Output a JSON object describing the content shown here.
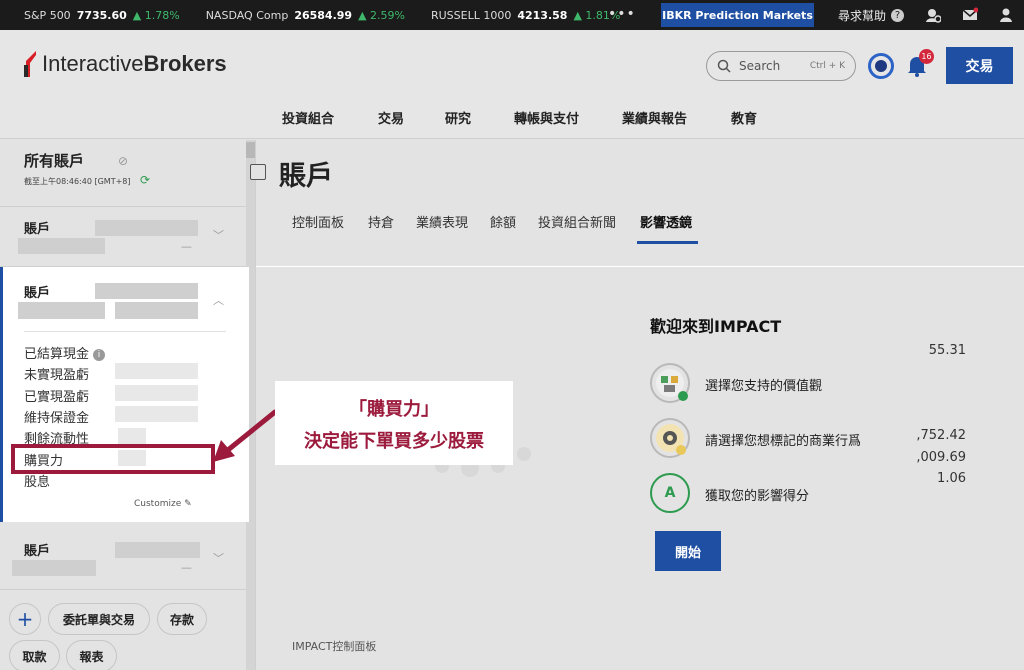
{
  "ticker": [
    {
      "name": "S&P 500",
      "value": "7735.60",
      "change": "▲ 1.78%"
    },
    {
      "name": "NASDAQ Comp",
      "value": "26584.99",
      "change": "▲ 2.59%"
    },
    {
      "name": "RUSSELL 1000",
      "value": "4213.58",
      "change": "▲ 1.81%"
    }
  ],
  "topbar": {
    "more": "•••",
    "predict_label": "IBKR Prediction Markets",
    "help_label": "尋求幫助"
  },
  "brand": {
    "name_regular": "Interactive",
    "name_bold": "Brokers"
  },
  "search": {
    "placeholder": "Search",
    "shortcut": "Ctrl + K"
  },
  "notifications": {
    "count": "16"
  },
  "trade_button": "交易",
  "nav": [
    "投資組合",
    "交易",
    "研究",
    "轉帳與支付",
    "業績與報告",
    "教育"
  ],
  "sidebar": {
    "title": "所有賬戶",
    "as_of": "截至上午08:46:40 [GMT+8]",
    "account_label": "賬戶",
    "rows": [
      {
        "label": "已結算現金",
        "value": "55.31"
      },
      {
        "label": "未實現盈虧",
        "value": ""
      },
      {
        "label": "已實現盈虧",
        "value": ""
      },
      {
        "label": "維持保證金",
        "value": ""
      },
      {
        "label": "剩餘流動性",
        "value": ",752.42"
      },
      {
        "label": "購買力",
        "value": ",009.69"
      },
      {
        "label": "股息",
        "value": "1.06"
      }
    ],
    "customize": "Customize",
    "buttons": {
      "orders": "委託單與交易",
      "deposit": "存款",
      "withdraw": "取款",
      "reports": "報表",
      "plus": "+"
    }
  },
  "main": {
    "title": "賬戶",
    "tabs": [
      "控制面板",
      "持倉",
      "業績表現",
      "餘額",
      "投資組合新聞",
      "影響透鏡"
    ],
    "active_tab": "影響透鏡",
    "welcome": "歡迎來到IMPACT",
    "steps": [
      "選擇您支持的價值觀",
      "請選擇您想標記的商業行爲",
      "獲取您的影響得分"
    ],
    "step_grade": "A",
    "start": "開始",
    "footer": "IMPACT控制面板"
  },
  "callout": {
    "line1": "「購買力」",
    "line2": "決定能下單買多少股票",
    "color": "#9c1b3d"
  },
  "colors": {
    "brand_blue": "#1f4fa3",
    "positive": "#3fb86b",
    "ibkr_red": "#d81f26"
  }
}
